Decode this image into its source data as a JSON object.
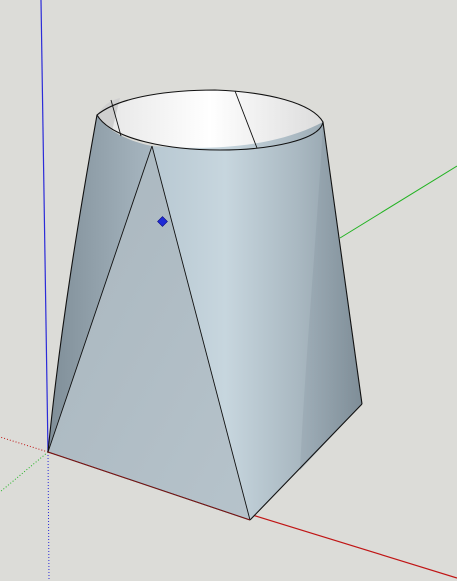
{
  "scene": {
    "description_visible_text": "",
    "background_color": "#dcdcd8",
    "model_color": "#b9c6cf",
    "model_light_color": "#c8d6de",
    "model_shadow_color": "#8fa0ab",
    "interior_color": "#ffffff",
    "edge_color": "#111111",
    "selection_point_color": "#1f2bd6"
  },
  "axes": {
    "red": "#c01515",
    "green": "#22b322",
    "blue": "#2b2bd8"
  },
  "icons": {
    "selection_point": "vertex-marker-icon"
  }
}
